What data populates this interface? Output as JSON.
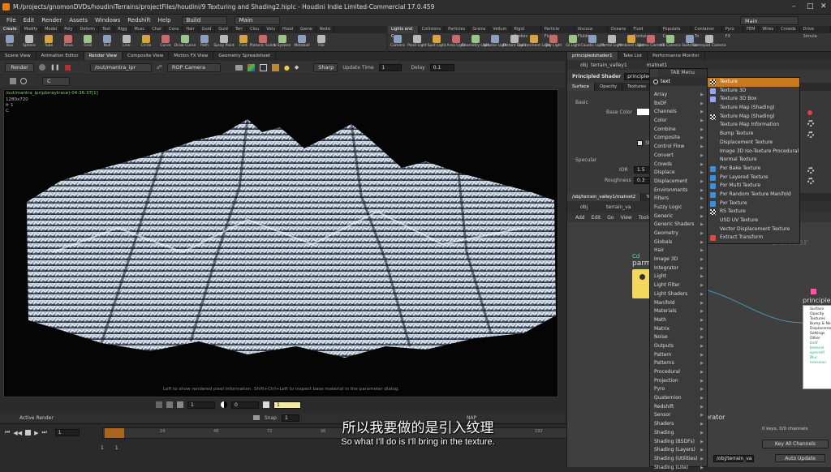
{
  "window": {
    "title": "M:/projects/gnomonDVDs/houdiniTerrains/projectFiles/houdini/9 Texturing and Shading2.hiplc - Houdini Indie Limited-Commercial 17.0.459"
  },
  "menubar": {
    "items": [
      "File",
      "Edit",
      "Render",
      "Assets",
      "Windows",
      "Redshift",
      "Help"
    ],
    "desktop": "Build",
    "desktop2": "Main",
    "desktop_right": "Main"
  },
  "shelf_left": {
    "tabs": [
      "Create",
      "Modify",
      "Model",
      "Poly",
      "Deform",
      "Text",
      "Rigg",
      "Musc",
      "Char",
      "Cons",
      "Hair",
      "Guid",
      "Guid",
      "Terr",
      "Clou",
      "Volu",
      "Hood",
      "Game",
      "Redsi"
    ],
    "tools": [
      "Box",
      "Sphere",
      "Tube",
      "Torus",
      "Grid",
      "Null",
      "Line",
      "Circle",
      "Curve",
      "Draw Curve",
      "Path",
      "Spray Paint",
      "Font",
      "Platonic Solids",
      "L-System",
      "Metaball",
      "File"
    ]
  },
  "shelf_right": {
    "tabs": [
      "Lights and C",
      "Collisions",
      "Particles",
      "Grains",
      "Vellum",
      "Rigid Bodies",
      "Particle Fluids",
      "Viscous Fluids",
      "Oceans",
      "Fluid Contai",
      "Populate Con",
      "Container To",
      "Pyro FX",
      "FEM",
      "Wires",
      "Crowds",
      "Drive Simula"
    ],
    "tools": [
      "Camera",
      "Point Light",
      "Spot Light",
      "Area Light",
      "Geometry Light",
      "Volume Light",
      "Distant Light",
      "Environment Light",
      "Sky Light",
      "GI Light",
      "Caustic Light",
      "Portal Light",
      "Ambient Light",
      "Stereo Camera",
      "VR Camera",
      "Switcher",
      "Gamepad Camera"
    ]
  },
  "left_panel": {
    "tabs": [
      "Scene View",
      "Animation Editor",
      "Render View",
      "Composite View",
      "Motion FX View",
      "Geometry Spreadsheet"
    ],
    "render_button": "Render",
    "out_path": "/out/mantra_ipr",
    "camera": "ROP Camera",
    "sharp": "Sharp",
    "update_time_label": "Update Time",
    "update_time_value": "1",
    "delay_label": "Delay",
    "delay_value": "0.1",
    "channel": "C",
    "vp_path": "/out/mantra_ipr(pbrraytrace)-04:36:37[1]",
    "vp_res": "1280x720",
    "vp_frame": "fr 1",
    "vp_channel": "C",
    "hint": "Left to show rendered pixel information. Shift+Ctrl+Left to inspect base material in the parameter dialog.",
    "bottom_field_a": "1",
    "bottom_field_b": "0",
    "bottom_field_c": "1",
    "active_render": "Active Render",
    "snap_label": "Snap",
    "snap_value": "1",
    "snap_tag": "NAP"
  },
  "timeline": {
    "frame": "1",
    "start": "1",
    "end": "1",
    "ticks": [
      "24",
      "48",
      "72",
      "96",
      "120",
      "144",
      "168",
      "192",
      "216",
      "240"
    ]
  },
  "right_top": {
    "tabs": [
      "principledshader1",
      "Take List",
      "Performance Monitor"
    ],
    "path_obj": "obj",
    "path_a": "terrain_valley1",
    "path_b": "matnet1",
    "shader_label": "Principled Shader",
    "shader_name": "principledshader1",
    "param_tabs": [
      "Surface",
      "Opacity",
      "Textures"
    ],
    "basic": "Basic",
    "base_color": "Base Color",
    "specular": "Specular",
    "ior_label": "IOR",
    "ior_value": "1.5",
    "rough_label": "Roughness",
    "rough_value": "0.3",
    "side_u1": "Us",
    "side_u2": "Us",
    "side_sh": "Sh"
  },
  "right_bottom": {
    "tabs": [
      "/obj/terrain_valley1/matnet2",
      "Tree View"
    ],
    "path_obj": "obj",
    "path_a": "terrain_va",
    "menus": [
      "Add",
      "Edit",
      "Go",
      "View",
      "Tools"
    ],
    "node_cd": "Cd",
    "node_parm": "parm",
    "builder": "Builder",
    "principled": "principle",
    "ports": [
      "Surface",
      "Opacity",
      "Textures",
      "Bump & Norm",
      "Displacement",
      "Settings",
      "Other"
    ],
    "ports2": [
      "bsdf",
      "basecol",
      "specrefl",
      "Blur",
      "emission"
    ],
    "erator": "erator",
    "keys_label": "0 keys, 0/0 channels",
    "key_all": "Key All Channels",
    "bottom_path": "/obj/terrain_va",
    "auto_update": "Auto Update"
  },
  "tab_menu": {
    "title": "TAB Menu",
    "search": "text",
    "categories": [
      "Array",
      "BxDF",
      "Channels",
      "Color",
      "Combine",
      "Composite",
      "Control Flow",
      "Convert",
      "Crowds",
      "Displace",
      "Displacement",
      "Environments",
      "Filters",
      "Fuzzy Logic",
      "Generic",
      "Generic Shaders",
      "Geometry",
      "Globals",
      "Hair",
      "Image 3D",
      "Integrator",
      "Light",
      "Light Filter",
      "Light Shaders",
      "Manifold",
      "Materials",
      "Math",
      "Matrix",
      "Noise",
      "Outputs",
      "Pattern",
      "Patterns",
      "Procedural",
      "Projection",
      "Pyro",
      "Quaternion",
      "Redshift",
      "Sensor",
      "Shaders",
      "Shading",
      "Shading (BSDFs)",
      "Shading (Layers)",
      "Shading (Utilities)",
      "Shading (Lite)"
    ],
    "results": [
      {
        "label": "Texture",
        "icon": "checker-icon",
        "color": "#eeeeee"
      },
      {
        "label": "Texture 3D",
        "icon": "cube-icon",
        "color": "#9aa4ff"
      },
      {
        "label": "Texture 3D Box",
        "icon": "cube-icon",
        "color": "#9aa4ff"
      },
      {
        "label": "Texture Map (Shading)",
        "icon": "none",
        "color": ""
      },
      {
        "label": "Texture Map (Shading)",
        "icon": "checker-icon",
        "color": "#eeeeee"
      },
      {
        "label": "Texture Map Information",
        "icon": "none",
        "color": ""
      },
      {
        "label": "Bump Texture",
        "icon": "none",
        "color": ""
      },
      {
        "label": "Displacement Texture",
        "icon": "none",
        "color": ""
      },
      {
        "label": "Image 3D Iso-Texture Procedural",
        "icon": "none",
        "color": ""
      },
      {
        "label": "Normal Texture",
        "icon": "none",
        "color": ""
      },
      {
        "label": "Pxr Bake Texture",
        "icon": "renderman-icon",
        "color": "#3a8fe0"
      },
      {
        "label": "Pxr Layered Texture",
        "icon": "renderman-icon",
        "color": "#3a8fe0"
      },
      {
        "label": "Pxr Multi Texture",
        "icon": "renderman-icon",
        "color": "#3a8fe0"
      },
      {
        "label": "Pxr Random Texture Manifold",
        "icon": "renderman-icon",
        "color": "#3a8fe0"
      },
      {
        "label": "Pxr Texture",
        "icon": "renderman-icon",
        "color": "#3a8fe0"
      },
      {
        "label": "RS Texture",
        "icon": "checker-icon",
        "color": "#eeeeee"
      },
      {
        "label": "USD UV Texture",
        "icon": "none",
        "color": ""
      },
      {
        "label": "Vector Displacement Texture",
        "icon": "none",
        "color": ""
      },
      {
        "label": "Extract Transform",
        "icon": "redshift-icon",
        "color": "#e04a3a"
      }
    ]
  },
  "subtitles": {
    "cn": "所以我要做的是引入纹理",
    "en": "So what I'll do is I'll bring in the texture."
  },
  "colors": {
    "accent": "#c87a1e",
    "node_yellow": "#f2d85c"
  }
}
